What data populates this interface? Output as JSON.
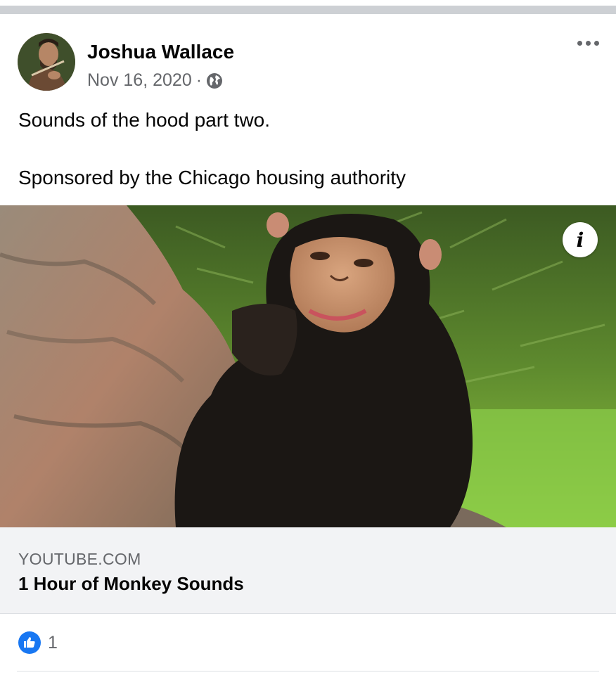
{
  "post": {
    "author": "Joshua Wallace",
    "date": "Nov 16, 2020",
    "separator": "·",
    "privacy_icon": "globe-icon",
    "more_icon": "more-options-icon",
    "text": "Sounds of the hood part two.\n\nSponsored by the Chicago housing authority"
  },
  "media": {
    "info_icon": "i"
  },
  "link_preview": {
    "domain": "YOUTUBE.COM",
    "title": "1 Hour of Monkey Sounds"
  },
  "reactions": {
    "icon": "like-icon",
    "count": "1",
    "like_color": "#1877f2"
  }
}
